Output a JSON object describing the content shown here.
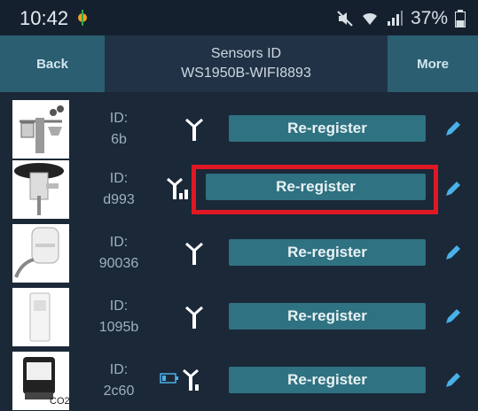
{
  "status": {
    "time": "10:42",
    "battery": "37%"
  },
  "header": {
    "back_label": "Back",
    "title_line1": "Sensors ID",
    "title_line2": "WS1950B-WIFI8893",
    "more_label": "More"
  },
  "sensors": [
    {
      "id_label": "ID:",
      "id_value": "6b",
      "action_label": "Re-register",
      "signal": "full"
    },
    {
      "id_label": "ID:",
      "id_value": "d993",
      "action_label": "Re-register",
      "signal": "weak",
      "highlighted": true
    },
    {
      "id_label": "ID:",
      "id_value": "90036",
      "action_label": "Re-register",
      "signal": "full"
    },
    {
      "id_label": "ID:",
      "id_value": "1095b",
      "action_label": "Re-register",
      "signal": "full"
    },
    {
      "id_label": "ID:",
      "id_value": "2c60",
      "action_label": "Re-register",
      "signal": "battery-low",
      "thumb_text": "CO2"
    }
  ],
  "colors": {
    "background": "#1b2838",
    "button": "#2f7281",
    "header_button": "#2a5e70",
    "highlight": "#e01824",
    "edit_icon": "#4ab0e8"
  }
}
